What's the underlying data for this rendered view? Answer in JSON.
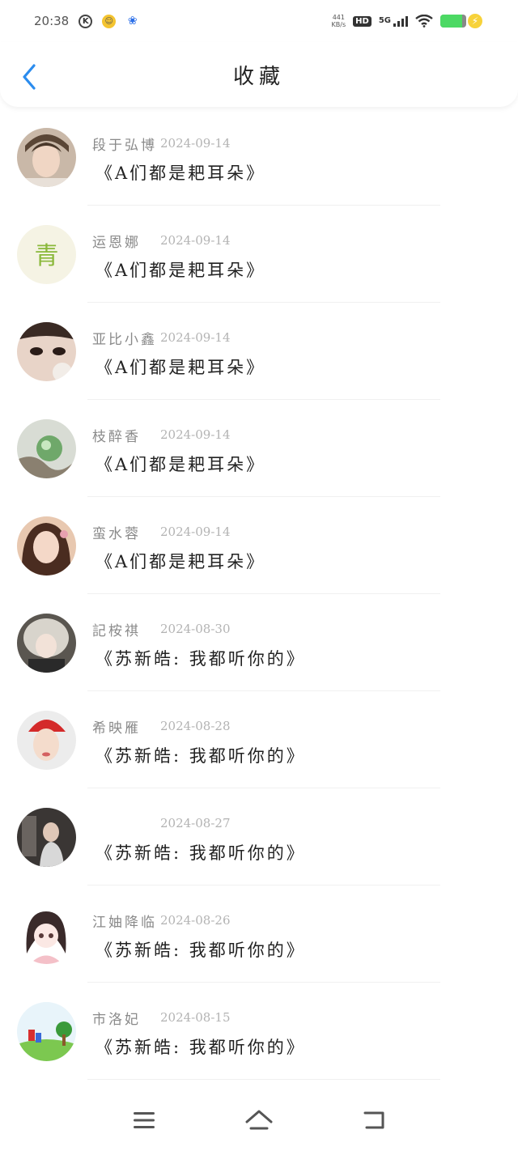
{
  "status_bar": {
    "time": "20:38",
    "net_speed_top": "441",
    "net_speed_bottom": "KB/s",
    "hd": "HD",
    "signal": "5G",
    "battery_level": 0.85,
    "icons": [
      "k-icon",
      "face-app-icon",
      "paw-icon",
      "wifi-icon",
      "battery-icon",
      "charging-icon"
    ]
  },
  "header": {
    "title": "收藏",
    "back_icon": "chevron-left-icon",
    "accent_color": "#2b8cee"
  },
  "favorites": [
    {
      "username": "段于弘博",
      "date": "2024-09-14",
      "title": "《A们都是耙耳朵》",
      "avatar": "portrait-boy"
    },
    {
      "username": "运恩娜",
      "date": "2024-09-14",
      "title": "《A们都是耙耳朵》",
      "avatar": "calligraphy-logo"
    },
    {
      "username": "亚比小鑫",
      "date": "2024-09-14",
      "title": "《A们都是耙耳朵》",
      "avatar": "portrait-closeup"
    },
    {
      "username": "枝醉香",
      "date": "2024-09-14",
      "title": "《A们都是耙耳朵》",
      "avatar": "green-marble"
    },
    {
      "username": "蛮水蓉",
      "date": "2024-09-14",
      "title": "《A们都是耙耳朵》",
      "avatar": "portrait-girl"
    },
    {
      "username": "記桉祺",
      "date": "2024-08-30",
      "title": "《苏新皓: 我都听你的》",
      "avatar": "portrait-fur-hat"
    },
    {
      "username": "希映雁",
      "date": "2024-08-28",
      "title": "《苏新皓: 我都听你的》",
      "avatar": "portrait-red-hat"
    },
    {
      "username": "",
      "date": "2024-08-27",
      "title": "《苏新皓: 我都听你的》",
      "avatar": "photo-dark"
    },
    {
      "username": "江妯降临",
      "date": "2024-08-26",
      "title": "《苏新皓: 我都听你的》",
      "avatar": "anime-girl"
    },
    {
      "username": "市洛妃",
      "date": "2024-08-15",
      "title": "《苏新皓: 我都听你的》",
      "avatar": "cartoon-park"
    }
  ],
  "bottom_nav": {
    "items": [
      "menu-icon",
      "home-icon",
      "back-icon"
    ]
  }
}
